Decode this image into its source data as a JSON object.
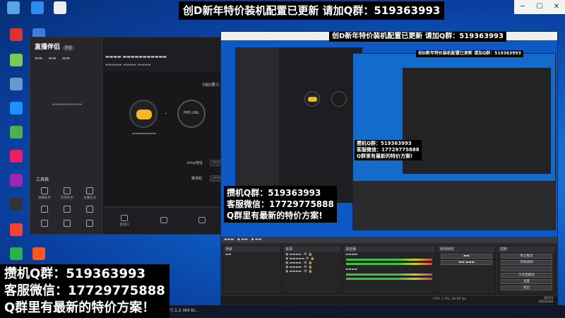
{
  "banners": {
    "top": "创D新年特价装机配置已更新 请加Q群：519363993",
    "nested_top": "创D新年特价装机配置已更新 请加Q群：519363993",
    "nested_small": "创D新年特价装机配置已更新 请加Q群：519363993",
    "mid_lines": [
      "攒机Q群：519363993",
      "客服微信：17729775888",
      "Q群里有最新的特价方案!"
    ],
    "small_lines": [
      "攒机Q群：519363993",
      "客服微信：17729775888",
      "Q群里有最新的特价方案!"
    ],
    "big_lines": [
      "攒机Q群：519363993",
      "客服微信：17729775888",
      "Q群里有最新的特价方案！"
    ]
  },
  "app": {
    "logo": "直播伴侣",
    "badge": "抖音",
    "tools_title": "工具箱",
    "rtmp_label": "rtmp地址",
    "key_label": "推流码",
    "obs_label": "OBS第三",
    "pms_label": "PMS URL",
    "stage_left": "直播",
    "tool_labels": [
      "弹幕助手",
      "房管助手",
      "主播任务",
      "",
      "",
      "",
      "",
      "",
      ""
    ],
    "bottom_labels": [
      "直播间",
      "",
      ""
    ]
  },
  "nested": {
    "obs_panels": [
      "场景",
      "来源",
      "混音器",
      "转场特效",
      "控制"
    ],
    "obs_control_buttons": [
      "停止推流",
      "开始录制",
      "",
      "工作室模式",
      "设置",
      "退出"
    ],
    "obs_status": "CPU: 1.3%, 30.00 fps",
    "clock_time": "16:53",
    "clock_date": "2022/2/4"
  },
  "taskbar": {
    "item": "31.27.1.2 (64 bi..."
  }
}
